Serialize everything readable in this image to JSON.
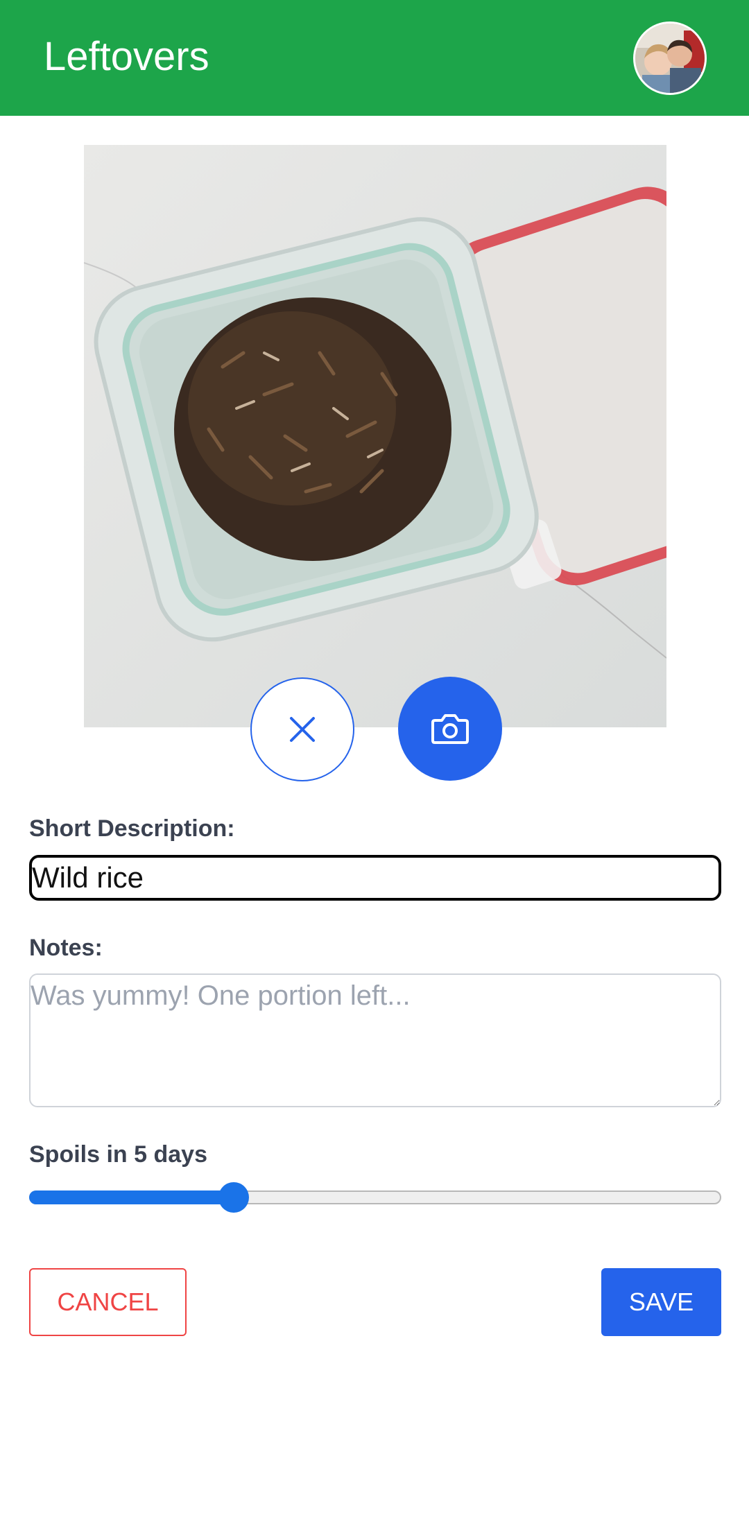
{
  "app_bar": {
    "title": "Leftovers",
    "background": "#1da54a",
    "avatar_icon": "user-avatar"
  },
  "photo": {
    "subject": "food-photo",
    "remove_icon": "close-icon",
    "camera_icon": "camera-icon"
  },
  "form": {
    "description_label": "Short Description:",
    "description_value": "Wild rice",
    "notes_label": "Notes:",
    "notes_placeholder": "Was yummy! One portion left...",
    "notes_value": "",
    "spoils_label": "Spoils in 5 days",
    "spoils_days": 5,
    "spoils_fraction": 0.295
  },
  "actions": {
    "cancel_label": "CANCEL",
    "save_label": "SAVE"
  },
  "colors": {
    "primary": "#2563eb",
    "danger": "#ef4444",
    "slider": "#1a73e8"
  }
}
